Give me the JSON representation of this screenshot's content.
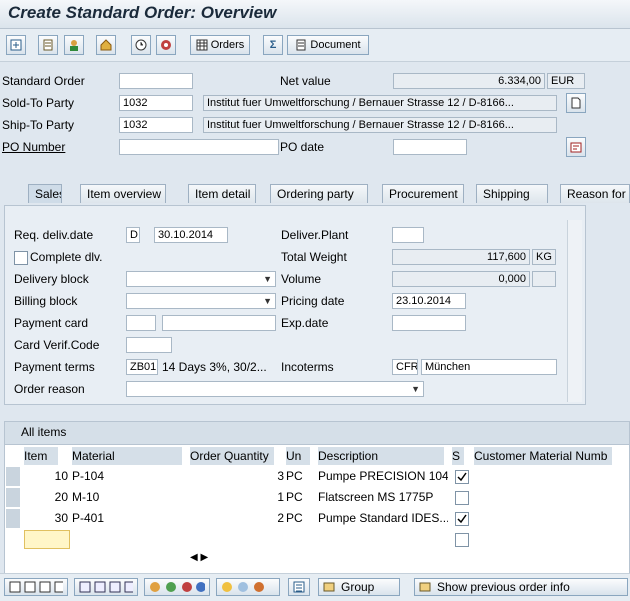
{
  "window": {
    "title": "Create Standard Order: Overview"
  },
  "toolbar": {
    "orders_label": "Orders",
    "document_label": "Document"
  },
  "header": {
    "standard_order_label": "Standard Order",
    "standard_order_value": "",
    "net_value_label": "Net value",
    "net_value": "6.334,00",
    "currency": "EUR",
    "sold_to_label": "Sold-To Party",
    "sold_to_value": "1032",
    "sold_to_name": "Institut fuer Umweltforschung / Bernauer Strasse 12 / D-8166...",
    "ship_to_label": "Ship-To Party",
    "ship_to_value": "1032",
    "ship_to_name": "Institut fuer Umweltforschung / Bernauer Strasse 12 / D-8166...",
    "po_number_label": "PO Number",
    "po_number_value": "",
    "po_date_label": "PO date",
    "po_date_value": ""
  },
  "tabs": [
    "Sales",
    "Item overview",
    "Item detail",
    "Ordering party",
    "Procurement",
    "Shipping",
    "Reason for r"
  ],
  "sales": {
    "req_deliv_label": "Req. deliv.date",
    "req_deliv_type": "D",
    "req_deliv_date": "30.10.2014",
    "deliver_plant_label": "Deliver.Plant",
    "deliver_plant_value": "",
    "complete_dlv_label": "Complete dlv.",
    "total_weight_label": "Total Weight",
    "total_weight_value": "117,600",
    "weight_unit": "KG",
    "delivery_block_label": "Delivery block",
    "delivery_block_value": "",
    "volume_label": "Volume",
    "volume_value": "0,000",
    "volume_unit": "",
    "billing_block_label": "Billing block",
    "billing_block_value": "",
    "pricing_date_label": "Pricing date",
    "pricing_date_value": "23.10.2014",
    "payment_card_label": "Payment card",
    "payment_card_value": "",
    "exp_date_label": "Exp.date",
    "exp_date_value": "",
    "card_verif_label": "Card Verif.Code",
    "card_verif_value": "",
    "payment_terms_label": "Payment terms",
    "payment_terms_code": "ZB01",
    "payment_terms_text": "14 Days 3%, 30/2...",
    "incoterms_label": "Incoterms",
    "incoterms_code": "CFR",
    "incoterms_place": "München",
    "order_reason_label": "Order reason",
    "order_reason_value": ""
  },
  "items": {
    "header_label": "All items",
    "columns": [
      "Item",
      "Material",
      "Order Quantity",
      "Un",
      "Description",
      "S",
      "Customer Material Numb"
    ],
    "rows": [
      {
        "item": "10",
        "material": "P-104",
        "qty": "3",
        "unit": "PC",
        "description": "Pumpe PRECISION 104",
        "s": true
      },
      {
        "item": "20",
        "material": "M-10",
        "qty": "1",
        "unit": "PC",
        "description": "Flatscreen MS 1775P",
        "s": false
      },
      {
        "item": "30",
        "material": "P-401",
        "qty": "2",
        "unit": "PC",
        "description": "Pumpe Standard IDES...",
        "s": true
      }
    ]
  },
  "bottom": {
    "group_label": "Group",
    "show_prev_label": "Show previous order info"
  }
}
